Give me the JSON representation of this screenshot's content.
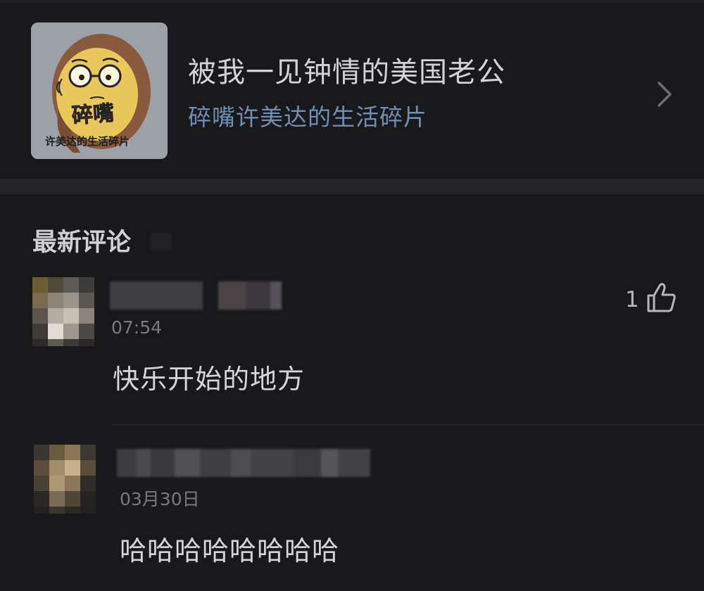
{
  "article": {
    "title": "被我一见钟情的美国老公",
    "author": "碎嘴许美达的生活碎片",
    "cover": {
      "icon": "cartoon-avatar-logo",
      "logo_text_main": "碎嘴",
      "logo_text_sub": "许美达的生活碎片"
    }
  },
  "comments_section": {
    "title": "最新评论"
  },
  "comments": [
    {
      "username": "",
      "time": "07:54",
      "text": "快乐开始的地方",
      "likes": "1"
    },
    {
      "username": "",
      "time": "03月30日",
      "text": "哈哈哈哈哈哈哈哈"
    }
  ],
  "colors": {
    "background": "#19191b",
    "title_text": "#d3d3d6",
    "author_link": "#6f8fb3",
    "separator": "#252529"
  }
}
